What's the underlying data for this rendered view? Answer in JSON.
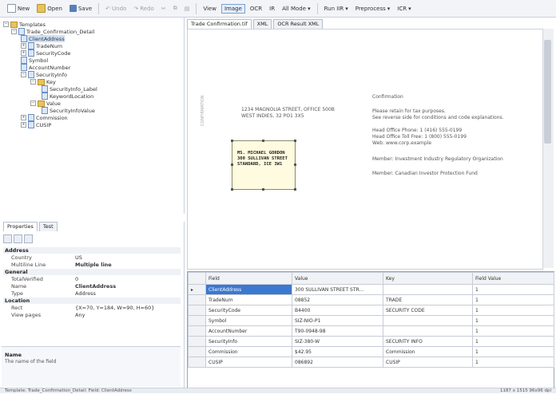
{
  "toolbar": {
    "new": "New",
    "open": "Open",
    "save": "Save",
    "undo": "Undo",
    "redo": "Redo",
    "view": "View",
    "image": "Image",
    "ocr": "OCR",
    "ir": "IR",
    "all_mode": "All Mode",
    "run_ir": "Run IIR",
    "preprocess": "Preprocess",
    "icr": "ICR"
  },
  "tree": {
    "root": "Templates",
    "template": "Trade_Confirmation_Detail",
    "items": [
      "ClientAddress",
      "TradeNum",
      "SecurityCode",
      "Symbol",
      "AccountNumber",
      "SecurityInfo",
      "Key",
      "SecurityInfo_Label",
      "KeywordLocation",
      "Value",
      "SecurityInfoValue",
      "Commission",
      "CUSIP"
    ]
  },
  "props": {
    "tabs": [
      "Properties",
      "Test"
    ],
    "rows": [
      {
        "k": "Address",
        "v": "",
        "cat": true
      },
      {
        "k": "Country",
        "v": "US"
      },
      {
        "k": "Multiline Line",
        "v": "Multiple line",
        "bold": true
      },
      {
        "k": "General",
        "v": "",
        "cat": true
      },
      {
        "k": "TotalVerified",
        "v": "0"
      },
      {
        "k": "Name",
        "v": "ClientAddress",
        "bold": true
      },
      {
        "k": "Type",
        "v": "Address"
      },
      {
        "k": "Location",
        "v": "",
        "cat": true
      },
      {
        "k": "Rect",
        "v": "{X=70, Y=184, W=90, H=60}"
      },
      {
        "k": "View pages",
        "v": "Any"
      }
    ],
    "desc_title": "Name",
    "desc_text": "The name of the field"
  },
  "doc": {
    "tabs": [
      "Trade Confirmation.tif",
      "XML",
      "OCR Result XML"
    ],
    "sender_line1": "1234 MAGNOLIA STREET, OFFICE 500B",
    "sender_line2": "WEST INDIES, 32 PO1 3X5",
    "side_stamp": "CONFIRMATION",
    "addr_lines": [
      "MS. MICHAEL GORDON",
      "300 SULLIVAN STREET",
      "STANDARD, ICE 3W1"
    ],
    "right_lines": [
      "Confirmation",
      "Please retain for tax purposes.",
      "See reverse side for conditions and code explanations.",
      "Head Office Phone: 1 (416) 555-0199",
      "Head Office Toll Free: 1 (800) 555-0199",
      "Web: www.corp.example",
      "Member: Investment Industry Regulatory Organization",
      "Member: Canadian Investor Protection Fund"
    ]
  },
  "grid": {
    "columns": [
      "Field",
      "Value",
      "Key",
      "Field Value"
    ],
    "rows": [
      {
        "field": "ClientAddress",
        "value": "300 SULLIVAN STREET STR...",
        "key": "",
        "fv": "1",
        "selected": true
      },
      {
        "field": "TradeNum",
        "value": "08852",
        "key": "TRADE",
        "fv": "1"
      },
      {
        "field": "SecurityCode",
        "value": "B4400",
        "key": "SECURITY CODE",
        "fv": "1"
      },
      {
        "field": "Symbol",
        "value": "SIZ-NIO-P1",
        "key": "",
        "fv": "1"
      },
      {
        "field": "AccountNumber",
        "value": "T90-0948-98",
        "key": "",
        "fv": "1"
      },
      {
        "field": "SecurityInfo",
        "value": "SIZ-380-W",
        "key": "SECURITY INFO",
        "fv": "1"
      },
      {
        "field": "Commission",
        "value": "$42.95",
        "key": "Commission",
        "fv": "1"
      },
      {
        "field": "CUSIP",
        "value": "086892",
        "key": "CUSIP",
        "fv": "1"
      }
    ]
  },
  "status": {
    "left": "Template: Trade_Confirmation_Detail: Field: ClientAddress",
    "right": "1187 x 1515   96x96 dpi"
  },
  "colors": {
    "accent": "#3b78d0",
    "selection": "#cfe0f6",
    "highlight_box": "#fffbe0"
  }
}
